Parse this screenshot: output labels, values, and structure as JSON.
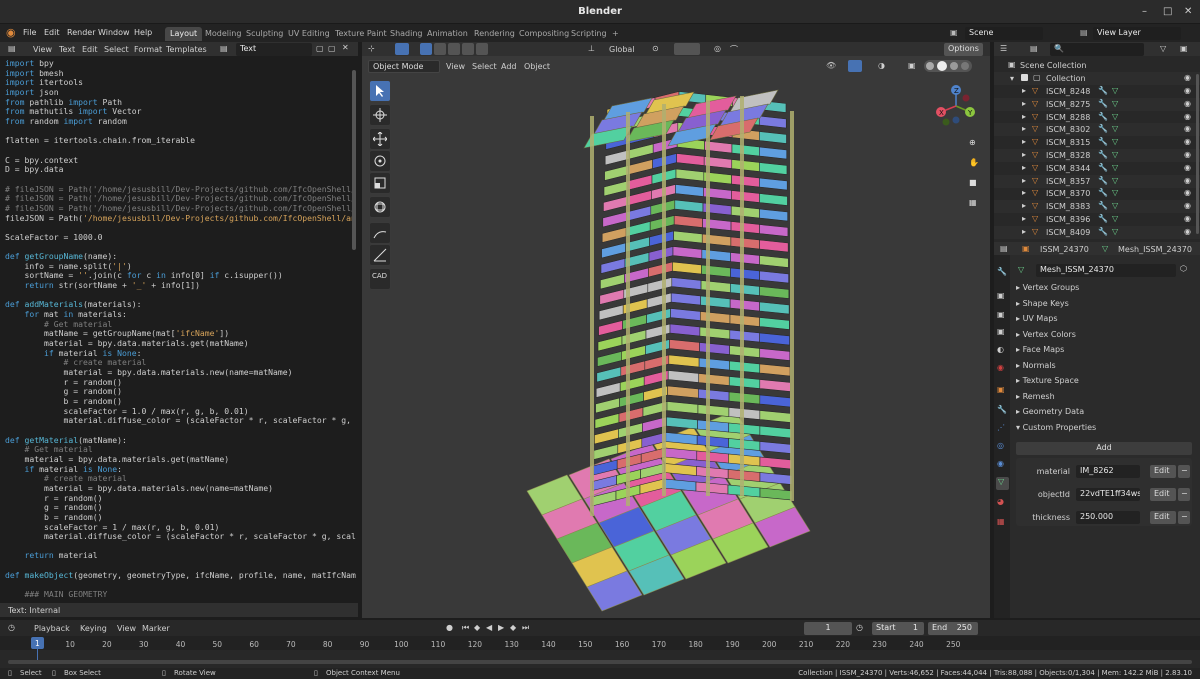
{
  "app": {
    "title": "Blender",
    "menus": [
      "File",
      "Edit",
      "Render",
      "Window",
      "Help"
    ],
    "workspaces": [
      "Layout",
      "Modeling",
      "Sculpting",
      "UV Editing",
      "Texture Paint",
      "Shading",
      "Animation",
      "Rendering",
      "Compositing",
      "Scripting"
    ],
    "scene": "Scene",
    "view_layer": "View Layer"
  },
  "text_editor": {
    "menus": [
      "View",
      "Text",
      "Edit",
      "Select",
      "Format",
      "Templates"
    ],
    "file_name": "Text",
    "footer": "Text: Internal"
  },
  "viewport": {
    "mode": "Object Mode",
    "menus": [
      "View",
      "Select",
      "Add",
      "Object"
    ],
    "transform_orientation": "Global",
    "options": "Options",
    "tool_cad": "CAD",
    "axes": {
      "x": "X",
      "y": "Y",
      "z": "Z"
    }
  },
  "outliner": {
    "root": "Scene Collection",
    "collection": "Collection",
    "items": [
      "ISCM_8248",
      "ISCM_8275",
      "ISCM_8288",
      "ISCM_8302",
      "ISCM_8315",
      "ISCM_8328",
      "ISCM_8344",
      "ISCM_8357",
      "ISCM_8370",
      "ISCM_8383",
      "ISCM_8396",
      "ISCM_8409"
    ]
  },
  "properties": {
    "object_name": "ISSM_24370",
    "mesh_name": "Mesh_ISSM_24370",
    "datablock": "Mesh_ISSM_24370",
    "panels": [
      "Vertex Groups",
      "Shape Keys",
      "UV Maps",
      "Vertex Colors",
      "Face Maps",
      "Normals",
      "Texture Space",
      "Remesh",
      "Geometry Data",
      "Custom Properties"
    ],
    "add_label": "Add",
    "edit_label": "Edit",
    "custom": [
      {
        "key": "material",
        "value": "IM_8262"
      },
      {
        "key": "objectId",
        "value": "22vdTE1ff34ws..."
      },
      {
        "key": "thickness",
        "value": "250.000"
      }
    ]
  },
  "timeline": {
    "menus": [
      "Playback",
      "Keying",
      "View",
      "Marker"
    ],
    "current_frame": "1",
    "start_label": "Start",
    "start": "1",
    "end_label": "End",
    "end": "250",
    "ticks": [
      "1",
      "10",
      "20",
      "30",
      "40",
      "50",
      "60",
      "70",
      "80",
      "90",
      "100",
      "110",
      "120",
      "130",
      "140",
      "150",
      "160",
      "170",
      "180",
      "190",
      "200",
      "210",
      "220",
      "230",
      "240",
      "250"
    ]
  },
  "statusbar": {
    "select": "Select",
    "box_select": "Box Select",
    "rotate": "Rotate View",
    "context": "Object Context Menu",
    "stats": "Collection | ISSM_24370 | Verts:46,652 | Faces:44,044 | Tris:88,088 | Objects:0/1,304 | Mem: 142.2 MiB | 2.83.10"
  },
  "colors": {
    "accent": "#4772b3",
    "header": "#303030",
    "editor_bg": "#1d1d1d",
    "viewport_bg": "#393939"
  }
}
